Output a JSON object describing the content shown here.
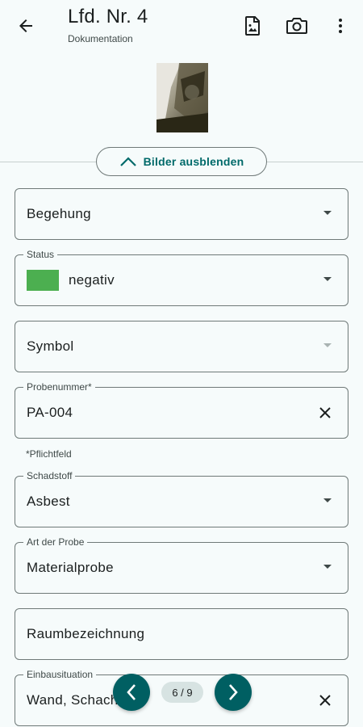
{
  "appbar": {
    "title": "Lfd. Nr. 4",
    "subtitle": "Dokumentation",
    "icons": {
      "back": "arrow-back-icon",
      "document": "image-document-icon",
      "camera": "camera-icon",
      "more": "more-vert-icon"
    }
  },
  "images": {
    "toggle_label": "Bilder ausblenden"
  },
  "form": {
    "begehung": {
      "value": "Begehung"
    },
    "status": {
      "label": "Status",
      "value": "negativ",
      "color": "#4caf50"
    },
    "symbol": {
      "value": "Symbol"
    },
    "probennummer": {
      "label": "Probenummer*",
      "value": "PA-004"
    },
    "required_note": "*Pflichtfeld",
    "schadstoff": {
      "label": "Schadstoff",
      "value": "Asbest"
    },
    "art_der_probe": {
      "label": "Art der Probe",
      "value": "Materialprobe"
    },
    "raumbezeichnung": {
      "value": "Raumbezeichnung"
    },
    "einbausituation": {
      "label": "Einbausituation",
      "value": "Wand, Schacht"
    }
  },
  "pager": {
    "indicator": "6 / 9"
  },
  "colors": {
    "accent": "#006a6a",
    "nav_button": "#005f62",
    "chip": "#d7e3e2",
    "background": "#f6fbfb"
  }
}
